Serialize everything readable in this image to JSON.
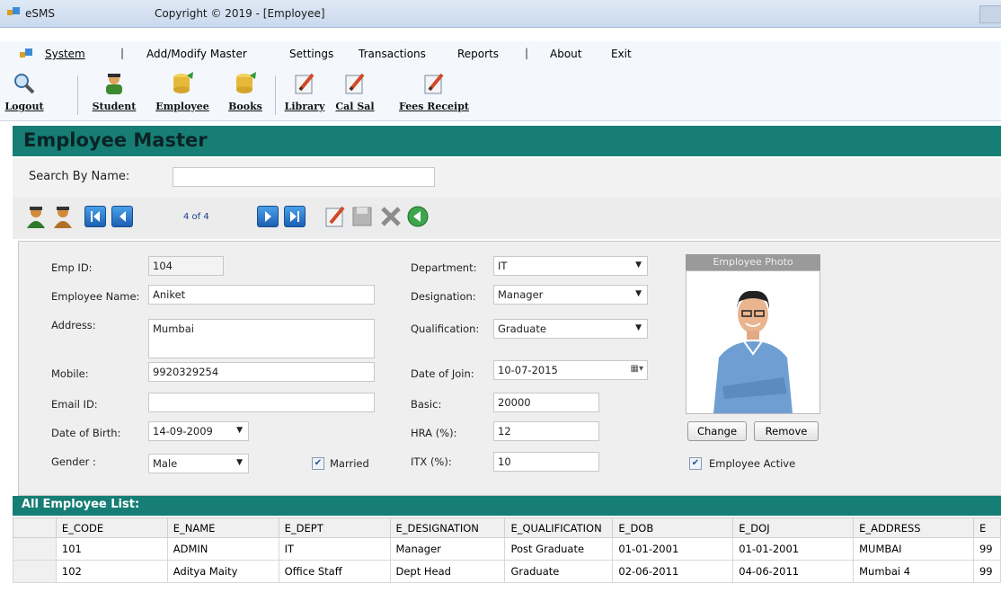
{
  "window": {
    "app_name": "eSMS",
    "title": "Copyright ©  2019 - [Employee]"
  },
  "menu": {
    "items": [
      "System",
      "Add/Modify Master",
      "Settings",
      "Transactions",
      "Reports",
      "About",
      "Exit"
    ],
    "separator": "|"
  },
  "toolbar": {
    "buttons": [
      {
        "label": "Logout",
        "icon": "magnifier-icon"
      },
      {
        "label": "Student",
        "icon": "student-icon"
      },
      {
        "label": "Employee",
        "icon": "database-icon"
      },
      {
        "label": "Books",
        "icon": "database-icon"
      },
      {
        "label": "Library",
        "icon": "pencil-doc-icon"
      },
      {
        "label": "Cal Sal",
        "icon": "pencil-doc-icon"
      },
      {
        "label": "Fees Receipt",
        "icon": "pencil-doc-icon"
      }
    ]
  },
  "page": {
    "title": "Employee Master"
  },
  "search": {
    "label": "Search By Name:",
    "value": ""
  },
  "navigator": {
    "position": "4 of 4"
  },
  "form": {
    "emp_id": {
      "label": "Emp ID:",
      "value": "104"
    },
    "employee_name": {
      "label": "Employee Name:",
      "value": "Aniket"
    },
    "address": {
      "label": "Address:",
      "value": "Mumbai"
    },
    "mobile": {
      "label": "Mobile:",
      "value": "9920329254"
    },
    "email": {
      "label": "Email ID:",
      "value": ""
    },
    "dob": {
      "label": "Date of Birth:",
      "value": "14-09-2009"
    },
    "gender": {
      "label": "Gender :",
      "value": "Male"
    },
    "married": {
      "label": "Married",
      "checked": true
    },
    "department": {
      "label": "Department:",
      "value": "IT"
    },
    "designation": {
      "label": "Designation:",
      "value": "Manager"
    },
    "qualification": {
      "label": "Qualification:",
      "value": "Graduate"
    },
    "doj": {
      "label": "Date of Join:",
      "value": "10-07-2015"
    },
    "basic": {
      "label": "Basic:",
      "value": "20000"
    },
    "hra": {
      "label": "HRA (%):",
      "value": "12"
    },
    "itx": {
      "label": "ITX (%):",
      "value": "10"
    },
    "photo": {
      "caption": "Employee Photo",
      "change_label": "Change",
      "remove_label": "Remove"
    },
    "active": {
      "label": "Employee Active",
      "checked": true
    }
  },
  "employee_list": {
    "title": "All Employee List:",
    "columns": [
      "E_CODE",
      "E_NAME",
      "E_DEPT",
      "E_DESIGNATION",
      "E_QUALIFICATION",
      "E_DOB",
      "E_DOJ",
      "E_ADDRESS",
      "E"
    ],
    "rows": [
      [
        "101",
        "ADMIN",
        "IT",
        "Manager",
        "Post Graduate",
        "01-01-2001",
        "01-01-2001",
        "MUMBAI",
        "99"
      ],
      [
        "102",
        "Aditya Maity",
        "Office Staff",
        "Dept Head",
        "Graduate",
        "02-06-2011",
        "04-06-2011",
        "Mumbai 4",
        "99"
      ]
    ]
  },
  "colors": {
    "accent": "#167e74",
    "header_text": "#0a2326"
  }
}
